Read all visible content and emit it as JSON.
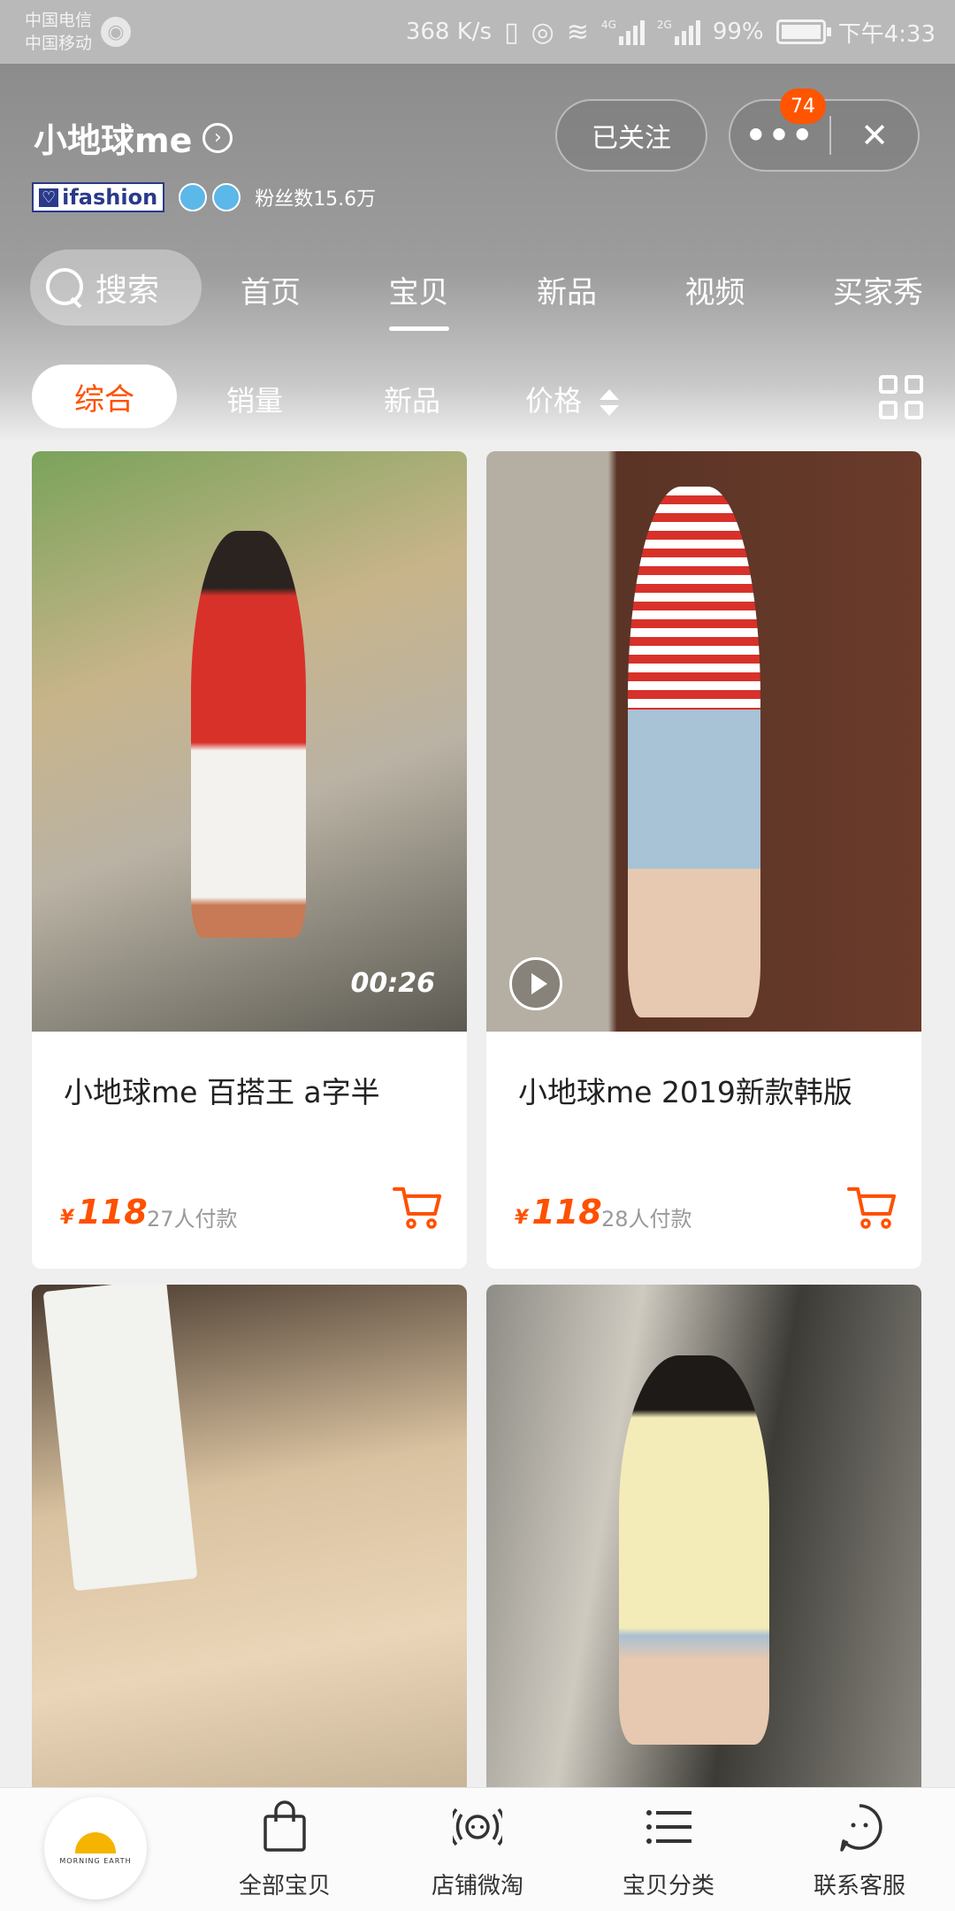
{
  "status_bar": {
    "carrier1": "中国电信",
    "carrier2": "中国移动",
    "speed": "368 K/s",
    "net1": "4G",
    "net2": "2G",
    "battery": "99%",
    "time": "下午4:33"
  },
  "shop": {
    "name": "小地球me",
    "brand_badge": "ifashion",
    "fans": "粉丝数15.6万",
    "follow_label": "已关注",
    "notification_count": "74"
  },
  "nav": {
    "search_label": "搜索",
    "tabs": [
      {
        "label": "首页"
      },
      {
        "label": "宝贝"
      },
      {
        "label": "新品"
      },
      {
        "label": "视频"
      },
      {
        "label": "买家秀"
      }
    ],
    "active_tab": "宝贝"
  },
  "sort": {
    "items": [
      {
        "label": "综合"
      },
      {
        "label": "销量"
      },
      {
        "label": "新品"
      },
      {
        "label": "价格"
      }
    ],
    "active": "综合"
  },
  "products": [
    {
      "title": "小地球me 百搭王 a字半",
      "currency": "¥",
      "price": "118",
      "buyers": "27人付款",
      "video_duration": "00:26"
    },
    {
      "title": "小地球me 2019新款韩版",
      "currency": "¥",
      "price": "118",
      "buyers": "28人付款"
    },
    {
      "title": ""
    },
    {
      "title": ""
    }
  ],
  "tabbar": {
    "logo_text": "MORNING EARTH",
    "items": [
      {
        "label": "全部宝贝",
        "icon": "shopping-bag-icon"
      },
      {
        "label": "店铺微淘",
        "icon": "broadcast-icon"
      },
      {
        "label": "宝贝分类",
        "icon": "list-icon"
      },
      {
        "label": "联系客服",
        "icon": "chat-face-icon"
      }
    ]
  },
  "colors": {
    "accent": "#ff5000",
    "header_gray": "#9a9a9a",
    "badge": "#ff5500"
  }
}
